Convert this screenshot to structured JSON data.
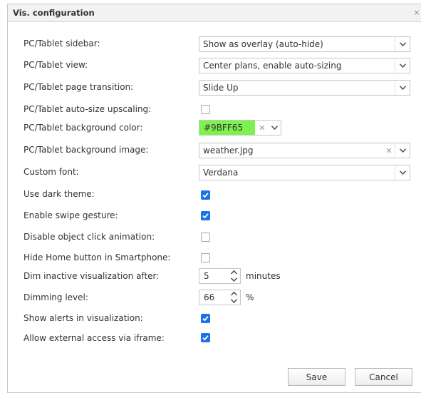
{
  "dialog": {
    "title": "Vis. configuration",
    "close_glyph": "×"
  },
  "fields": {
    "sidebar": {
      "label": "PC/Tablet sidebar:",
      "value": "Show as overlay (auto-hide)"
    },
    "view": {
      "label": "PC/Tablet view:",
      "value": "Center plans, enable auto-sizing"
    },
    "transition": {
      "label": "PC/Tablet page transition:",
      "value": "Slide Up"
    },
    "upscaling": {
      "label": "PC/Tablet auto-size upscaling:",
      "checked": false
    },
    "bg_color": {
      "label": "PC/Tablet background color:",
      "value": "#9BFF65",
      "swatch_color": "#7df24d"
    },
    "bg_image": {
      "label": "PC/Tablet background image:",
      "value": "weather.jpg"
    },
    "font": {
      "label": "Custom font:",
      "value": "Verdana"
    },
    "dark_theme": {
      "label": "Use dark theme:",
      "checked": true
    },
    "swipe": {
      "label": "Enable swipe gesture:",
      "checked": true
    },
    "click_anim": {
      "label": "Disable object click animation:",
      "checked": false
    },
    "home_btn": {
      "label": "Hide Home button in Smartphone:",
      "checked": false
    },
    "dim_after": {
      "label": "Dim inactive visualization after:",
      "value": "5",
      "unit": "minutes"
    },
    "dim_level": {
      "label": "Dimming level:",
      "value": "66",
      "unit": "%"
    },
    "alerts": {
      "label": "Show alerts in visualization:",
      "checked": true
    },
    "iframe": {
      "label": "Allow external access via iframe:",
      "checked": true
    }
  },
  "footer": {
    "save_label": "Save",
    "cancel_label": "Cancel"
  },
  "colors": {
    "accent": "#1a73e8"
  },
  "icons": {
    "dropdown": "chevron-down-icon",
    "clear": "clear-x-icon",
    "spinner": "spinner-arrows-icon",
    "check": "checkmark-icon"
  }
}
